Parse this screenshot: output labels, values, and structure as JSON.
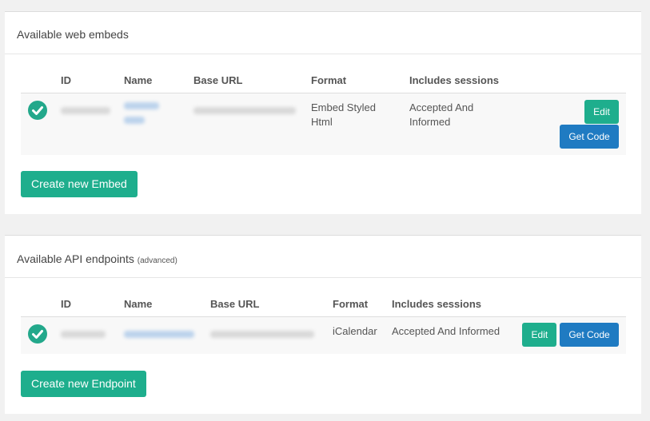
{
  "embeds": {
    "title": "Available web embeds",
    "columns": {
      "id": "ID",
      "name": "Name",
      "base_url": "Base URL",
      "format": "Format",
      "sessions": "Includes sessions"
    },
    "rows": [
      {
        "status_icon": "check-circle-icon",
        "format_line1": "Embed Styled",
        "format_line2": "Html",
        "sessions_line1": "Accepted And",
        "sessions_line2": "Informed",
        "edit_label": "Edit",
        "code_label": "Get Code"
      }
    ],
    "create_label": "Create new Embed"
  },
  "api": {
    "title": "Available API endpoints",
    "title_note": "(advanced)",
    "columns": {
      "id": "ID",
      "name": "Name",
      "base_url": "Base URL",
      "format": "Format",
      "sessions": "Includes sessions"
    },
    "rows": [
      {
        "status_icon": "check-circle-icon",
        "format": "iCalendar",
        "sessions": "Accepted And Informed",
        "edit_label": "Edit",
        "code_label": "Get Code"
      }
    ],
    "create_label": "Create new Endpoint"
  },
  "colors": {
    "accent_green": "#1eae8d",
    "accent_blue": "#1f7bc2",
    "page_bg": "#f1f1f1"
  }
}
